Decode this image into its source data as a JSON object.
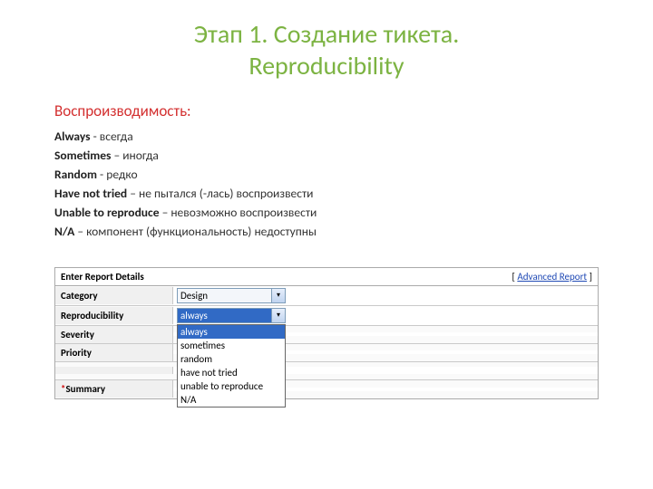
{
  "title_line1": "Этап 1. Создание тикета.",
  "title_line2": "Reproducibility",
  "subtitle": "Воспроизводимость:",
  "definitions": [
    {
      "term": "Always",
      "sep": " - ",
      "desc": "всегда"
    },
    {
      "term": "Sometimes",
      "sep": " – ",
      "desc": "иногда"
    },
    {
      "term": "Random",
      "sep": " - ",
      "desc": "редко"
    },
    {
      "term": "Have not tried",
      "sep": " – ",
      "desc": "не пытался (-лась) воспроизвести"
    },
    {
      "term": "Unable to reproduce",
      "sep": " – ",
      "desc": "невозможно воспроизвести"
    },
    {
      "term": "N/A",
      "sep": " – ",
      "desc": "компонент (функциональность) недоступны"
    }
  ],
  "form": {
    "header_title": "Enter Report Details",
    "adv_left": "[ ",
    "adv_link": "Advanced Report",
    "adv_right": " ]",
    "rows": {
      "category": {
        "label": "Category",
        "value": "Design"
      },
      "reproducibility": {
        "label": "Reproducibility",
        "value": "always"
      },
      "severity": {
        "label": "Severity"
      },
      "priority": {
        "label": "Priority"
      },
      "summary_ast": "*",
      "summary_label": "Summary"
    },
    "dropdown_options": [
      "always",
      "sometimes",
      "random",
      "have not tried",
      "unable to reproduce",
      "N/A"
    ]
  }
}
